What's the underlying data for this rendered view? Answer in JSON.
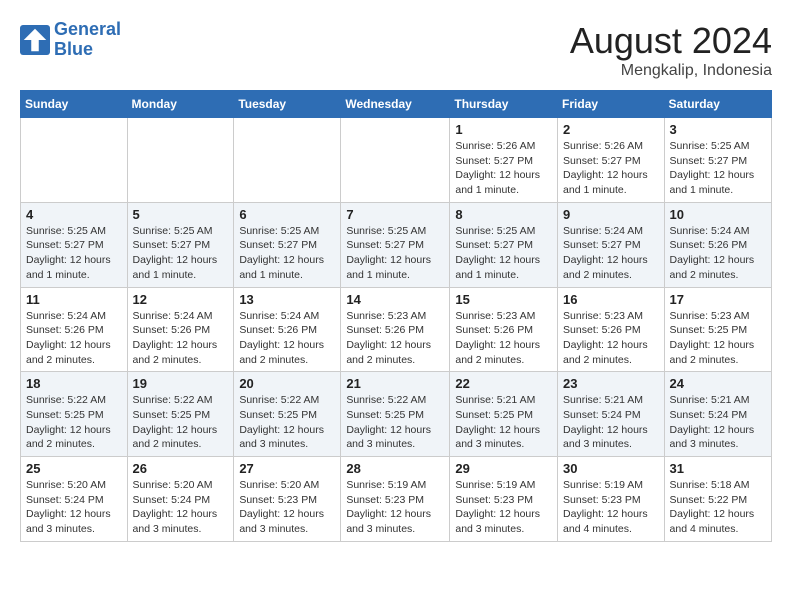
{
  "header": {
    "logo_line1": "General",
    "logo_line2": "Blue",
    "month": "August 2024",
    "location": "Mengkalip, Indonesia"
  },
  "weekdays": [
    "Sunday",
    "Monday",
    "Tuesday",
    "Wednesday",
    "Thursday",
    "Friday",
    "Saturday"
  ],
  "weeks": [
    [
      {
        "day": "",
        "info": ""
      },
      {
        "day": "",
        "info": ""
      },
      {
        "day": "",
        "info": ""
      },
      {
        "day": "",
        "info": ""
      },
      {
        "day": "1",
        "info": "Sunrise: 5:26 AM\nSunset: 5:27 PM\nDaylight: 12 hours and 1 minute."
      },
      {
        "day": "2",
        "info": "Sunrise: 5:26 AM\nSunset: 5:27 PM\nDaylight: 12 hours and 1 minute."
      },
      {
        "day": "3",
        "info": "Sunrise: 5:25 AM\nSunset: 5:27 PM\nDaylight: 12 hours and 1 minute."
      }
    ],
    [
      {
        "day": "4",
        "info": "Sunrise: 5:25 AM\nSunset: 5:27 PM\nDaylight: 12 hours and 1 minute."
      },
      {
        "day": "5",
        "info": "Sunrise: 5:25 AM\nSunset: 5:27 PM\nDaylight: 12 hours and 1 minute."
      },
      {
        "day": "6",
        "info": "Sunrise: 5:25 AM\nSunset: 5:27 PM\nDaylight: 12 hours and 1 minute."
      },
      {
        "day": "7",
        "info": "Sunrise: 5:25 AM\nSunset: 5:27 PM\nDaylight: 12 hours and 1 minute."
      },
      {
        "day": "8",
        "info": "Sunrise: 5:25 AM\nSunset: 5:27 PM\nDaylight: 12 hours and 1 minute."
      },
      {
        "day": "9",
        "info": "Sunrise: 5:24 AM\nSunset: 5:27 PM\nDaylight: 12 hours and 2 minutes."
      },
      {
        "day": "10",
        "info": "Sunrise: 5:24 AM\nSunset: 5:26 PM\nDaylight: 12 hours and 2 minutes."
      }
    ],
    [
      {
        "day": "11",
        "info": "Sunrise: 5:24 AM\nSunset: 5:26 PM\nDaylight: 12 hours and 2 minutes."
      },
      {
        "day": "12",
        "info": "Sunrise: 5:24 AM\nSunset: 5:26 PM\nDaylight: 12 hours and 2 minutes."
      },
      {
        "day": "13",
        "info": "Sunrise: 5:24 AM\nSunset: 5:26 PM\nDaylight: 12 hours and 2 minutes."
      },
      {
        "day": "14",
        "info": "Sunrise: 5:23 AM\nSunset: 5:26 PM\nDaylight: 12 hours and 2 minutes."
      },
      {
        "day": "15",
        "info": "Sunrise: 5:23 AM\nSunset: 5:26 PM\nDaylight: 12 hours and 2 minutes."
      },
      {
        "day": "16",
        "info": "Sunrise: 5:23 AM\nSunset: 5:26 PM\nDaylight: 12 hours and 2 minutes."
      },
      {
        "day": "17",
        "info": "Sunrise: 5:23 AM\nSunset: 5:25 PM\nDaylight: 12 hours and 2 minutes."
      }
    ],
    [
      {
        "day": "18",
        "info": "Sunrise: 5:22 AM\nSunset: 5:25 PM\nDaylight: 12 hours and 2 minutes."
      },
      {
        "day": "19",
        "info": "Sunrise: 5:22 AM\nSunset: 5:25 PM\nDaylight: 12 hours and 2 minutes."
      },
      {
        "day": "20",
        "info": "Sunrise: 5:22 AM\nSunset: 5:25 PM\nDaylight: 12 hours and 3 minutes."
      },
      {
        "day": "21",
        "info": "Sunrise: 5:22 AM\nSunset: 5:25 PM\nDaylight: 12 hours and 3 minutes."
      },
      {
        "day": "22",
        "info": "Sunrise: 5:21 AM\nSunset: 5:25 PM\nDaylight: 12 hours and 3 minutes."
      },
      {
        "day": "23",
        "info": "Sunrise: 5:21 AM\nSunset: 5:24 PM\nDaylight: 12 hours and 3 minutes."
      },
      {
        "day": "24",
        "info": "Sunrise: 5:21 AM\nSunset: 5:24 PM\nDaylight: 12 hours and 3 minutes."
      }
    ],
    [
      {
        "day": "25",
        "info": "Sunrise: 5:20 AM\nSunset: 5:24 PM\nDaylight: 12 hours and 3 minutes."
      },
      {
        "day": "26",
        "info": "Sunrise: 5:20 AM\nSunset: 5:24 PM\nDaylight: 12 hours and 3 minutes."
      },
      {
        "day": "27",
        "info": "Sunrise: 5:20 AM\nSunset: 5:23 PM\nDaylight: 12 hours and 3 minutes."
      },
      {
        "day": "28",
        "info": "Sunrise: 5:19 AM\nSunset: 5:23 PM\nDaylight: 12 hours and 3 minutes."
      },
      {
        "day": "29",
        "info": "Sunrise: 5:19 AM\nSunset: 5:23 PM\nDaylight: 12 hours and 3 minutes."
      },
      {
        "day": "30",
        "info": "Sunrise: 5:19 AM\nSunset: 5:23 PM\nDaylight: 12 hours and 4 minutes."
      },
      {
        "day": "31",
        "info": "Sunrise: 5:18 AM\nSunset: 5:22 PM\nDaylight: 12 hours and 4 minutes."
      }
    ]
  ]
}
